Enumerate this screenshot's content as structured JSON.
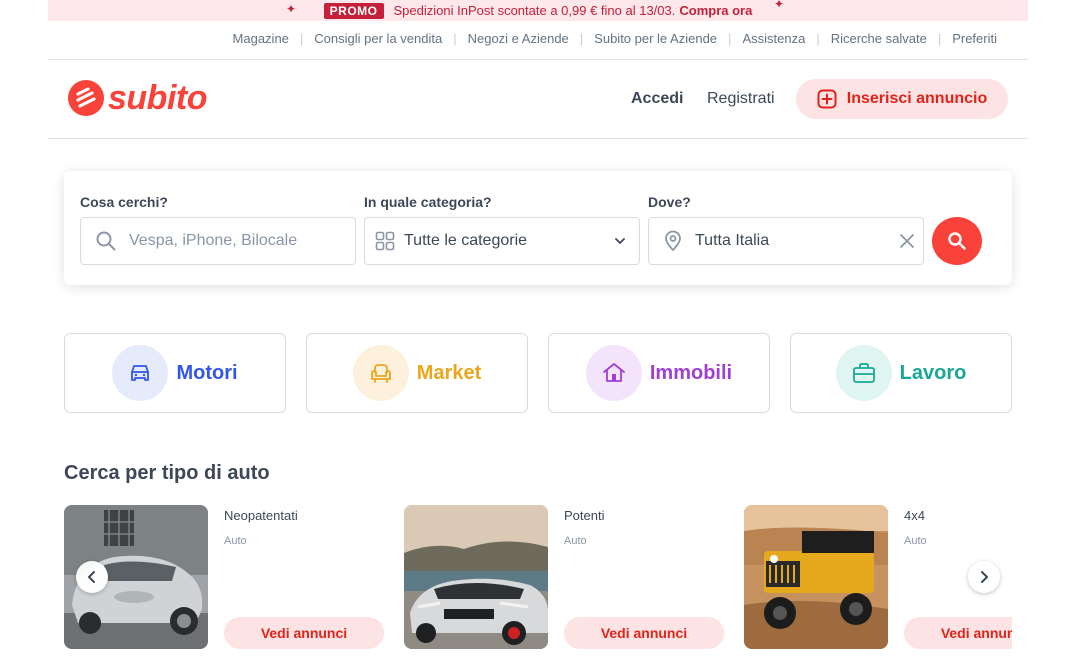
{
  "promo": {
    "badge": "PROMO",
    "text": "Spedizioni InPost scontate a 0,99 € fino al 13/03.",
    "cta": "Compra ora"
  },
  "toplinks": [
    "Magazine",
    "Consigli per la vendita",
    "Negozi e Aziende",
    "Subito per le Aziende",
    "Assistenza",
    "Ricerche salvate",
    "Preferiti"
  ],
  "header": {
    "logo": "subito",
    "login": "Accedi",
    "register": "Registrati",
    "insert": "Inserisci annuncio"
  },
  "search": {
    "what_label": "Cosa cerchi?",
    "what_placeholder": "Vespa, iPhone, Bilocale",
    "category_label": "In quale categoria?",
    "category_value": "Tutte le categorie",
    "where_label": "Dove?",
    "where_value": "Tutta Italia"
  },
  "categories": [
    {
      "label": "Motori",
      "color": "#3355e8",
      "bg": "#e6ebfc"
    },
    {
      "label": "Market",
      "color": "#eda51c",
      "bg": "#fdf1dd"
    },
    {
      "label": "Immobili",
      "color": "#a03fd4",
      "bg": "#f3e3fb"
    },
    {
      "label": "Lavoro",
      "color": "#19a893",
      "bg": "#dff5f1"
    }
  ],
  "section": {
    "title": "Cerca per tipo di auto",
    "cards": [
      {
        "title": "Neopatentati",
        "subtitle": "Auto",
        "button": "Vedi annunci"
      },
      {
        "title": "Potenti",
        "subtitle": "Auto",
        "button": "Vedi annunci"
      },
      {
        "title": "4x4",
        "subtitle": "Auto",
        "button": "Vedi annunci"
      }
    ]
  }
}
